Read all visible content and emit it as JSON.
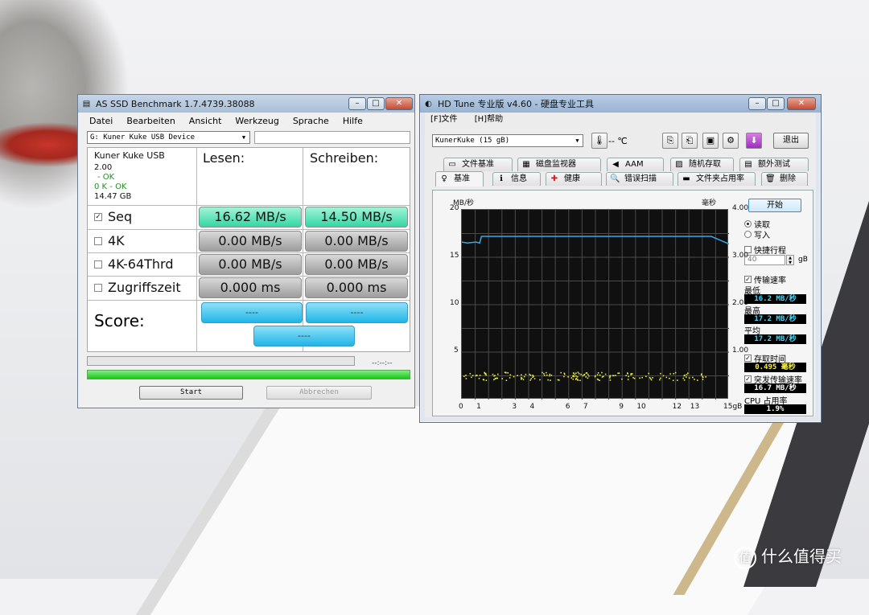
{
  "asssd": {
    "title": "AS SSD Benchmark 1.7.4739.38088",
    "menu": [
      "Datei",
      "Bearbeiten",
      "Ansicht",
      "Werkzeug",
      "Sprache",
      "Hilfe"
    ],
    "drive_select": "G: Kuner Kuke USB Device",
    "info": {
      "name": "Kuner Kuke USB",
      "version": "2.00",
      "status1": "- OK",
      "status2": "0 K - OK",
      "size": "14.47 GB"
    },
    "col_read": "Lesen:",
    "col_write": "Schreiben:",
    "rows": [
      {
        "label": "Seq",
        "checked": true,
        "read": "16.62 MB/s",
        "write": "14.50 MB/s"
      },
      {
        "label": "4K",
        "checked": false,
        "read": "0.00 MB/s",
        "write": "0.00 MB/s"
      },
      {
        "label": "4K-64Thrd",
        "checked": false,
        "read": "0.00 MB/s",
        "write": "0.00 MB/s"
      },
      {
        "label": "Zugriffszeit",
        "checked": false,
        "read": "0.000 ms",
        "write": "0.000 ms"
      }
    ],
    "score_label": "Score:",
    "score_read": "----",
    "score_write": "----",
    "score_total": "----",
    "elapsed": "--:--:--",
    "progress_top": 0,
    "progress_bottom": 1,
    "start_label": "Start",
    "cancel_label": "Abbrechen"
  },
  "hdtune": {
    "title": "HD Tune 专业版 v4.60 - 硬盘专业工具",
    "menu": [
      "[F]文件",
      "[H]帮助"
    ],
    "drive_select": "KunerKuke  (15 gB)",
    "temperature": "-- ℃",
    "exit_label": "退出",
    "tabs_row1": [
      "文件基准",
      "磁盘监视器",
      "AAM",
      "随机存取",
      "额外测试"
    ],
    "tabs_row2": [
      "基准",
      "信息",
      "健康",
      "错误扫描",
      "文件夹占用率",
      "删除"
    ],
    "start_button": "开始",
    "mode_read": "读取",
    "mode_write": "写入",
    "short_stroke": "快捷行程",
    "short_stroke_value": "40",
    "short_stroke_unit": "gB",
    "transfer_rate": "传输速率",
    "min_label": "最低",
    "min_value": "16.2 MB/秒",
    "max_label": "最高",
    "max_value": "17.2 MB/秒",
    "avg_label": "平均",
    "avg_value": "17.2 MB/秒",
    "access_time": "存取时间",
    "access_value": "0.495 毫秒",
    "burst_rate": "突发传输速率",
    "burst_value": "16.7 MB/秒",
    "cpu_label": "CPU 占用率",
    "cpu_value": "1.9%",
    "chart_data": {
      "type": "line",
      "y_left_unit": "MB/秒",
      "y_right_unit": "毫秒",
      "y_left_ticks": [
        "20",
        "15",
        "10",
        "5"
      ],
      "y_right_ticks": [
        "4.00",
        "3.00",
        "2.00",
        "1.00"
      ],
      "x_ticks": [
        "0",
        "1",
        "3",
        "4",
        "6",
        "7",
        "9",
        "10",
        "12",
        "13",
        "15gB"
      ],
      "ylim_left": [
        0,
        20
      ],
      "ylim_right": [
        0,
        4
      ],
      "xlim": [
        0,
        15
      ],
      "transfer_series": {
        "color": "#3aa7e8",
        "x": [
          0,
          0.3,
          0.8,
          1.0,
          1.1,
          2,
          4,
          6,
          8,
          10,
          12,
          14,
          15
        ],
        "y": [
          16.6,
          16.5,
          16.6,
          16.5,
          17.2,
          17.2,
          17.2,
          17.2,
          17.2,
          17.2,
          17.2,
          17.2,
          16.4
        ]
      },
      "access_series": {
        "color": "#e8e83a",
        "level_ms": 0.5
      }
    }
  }
}
